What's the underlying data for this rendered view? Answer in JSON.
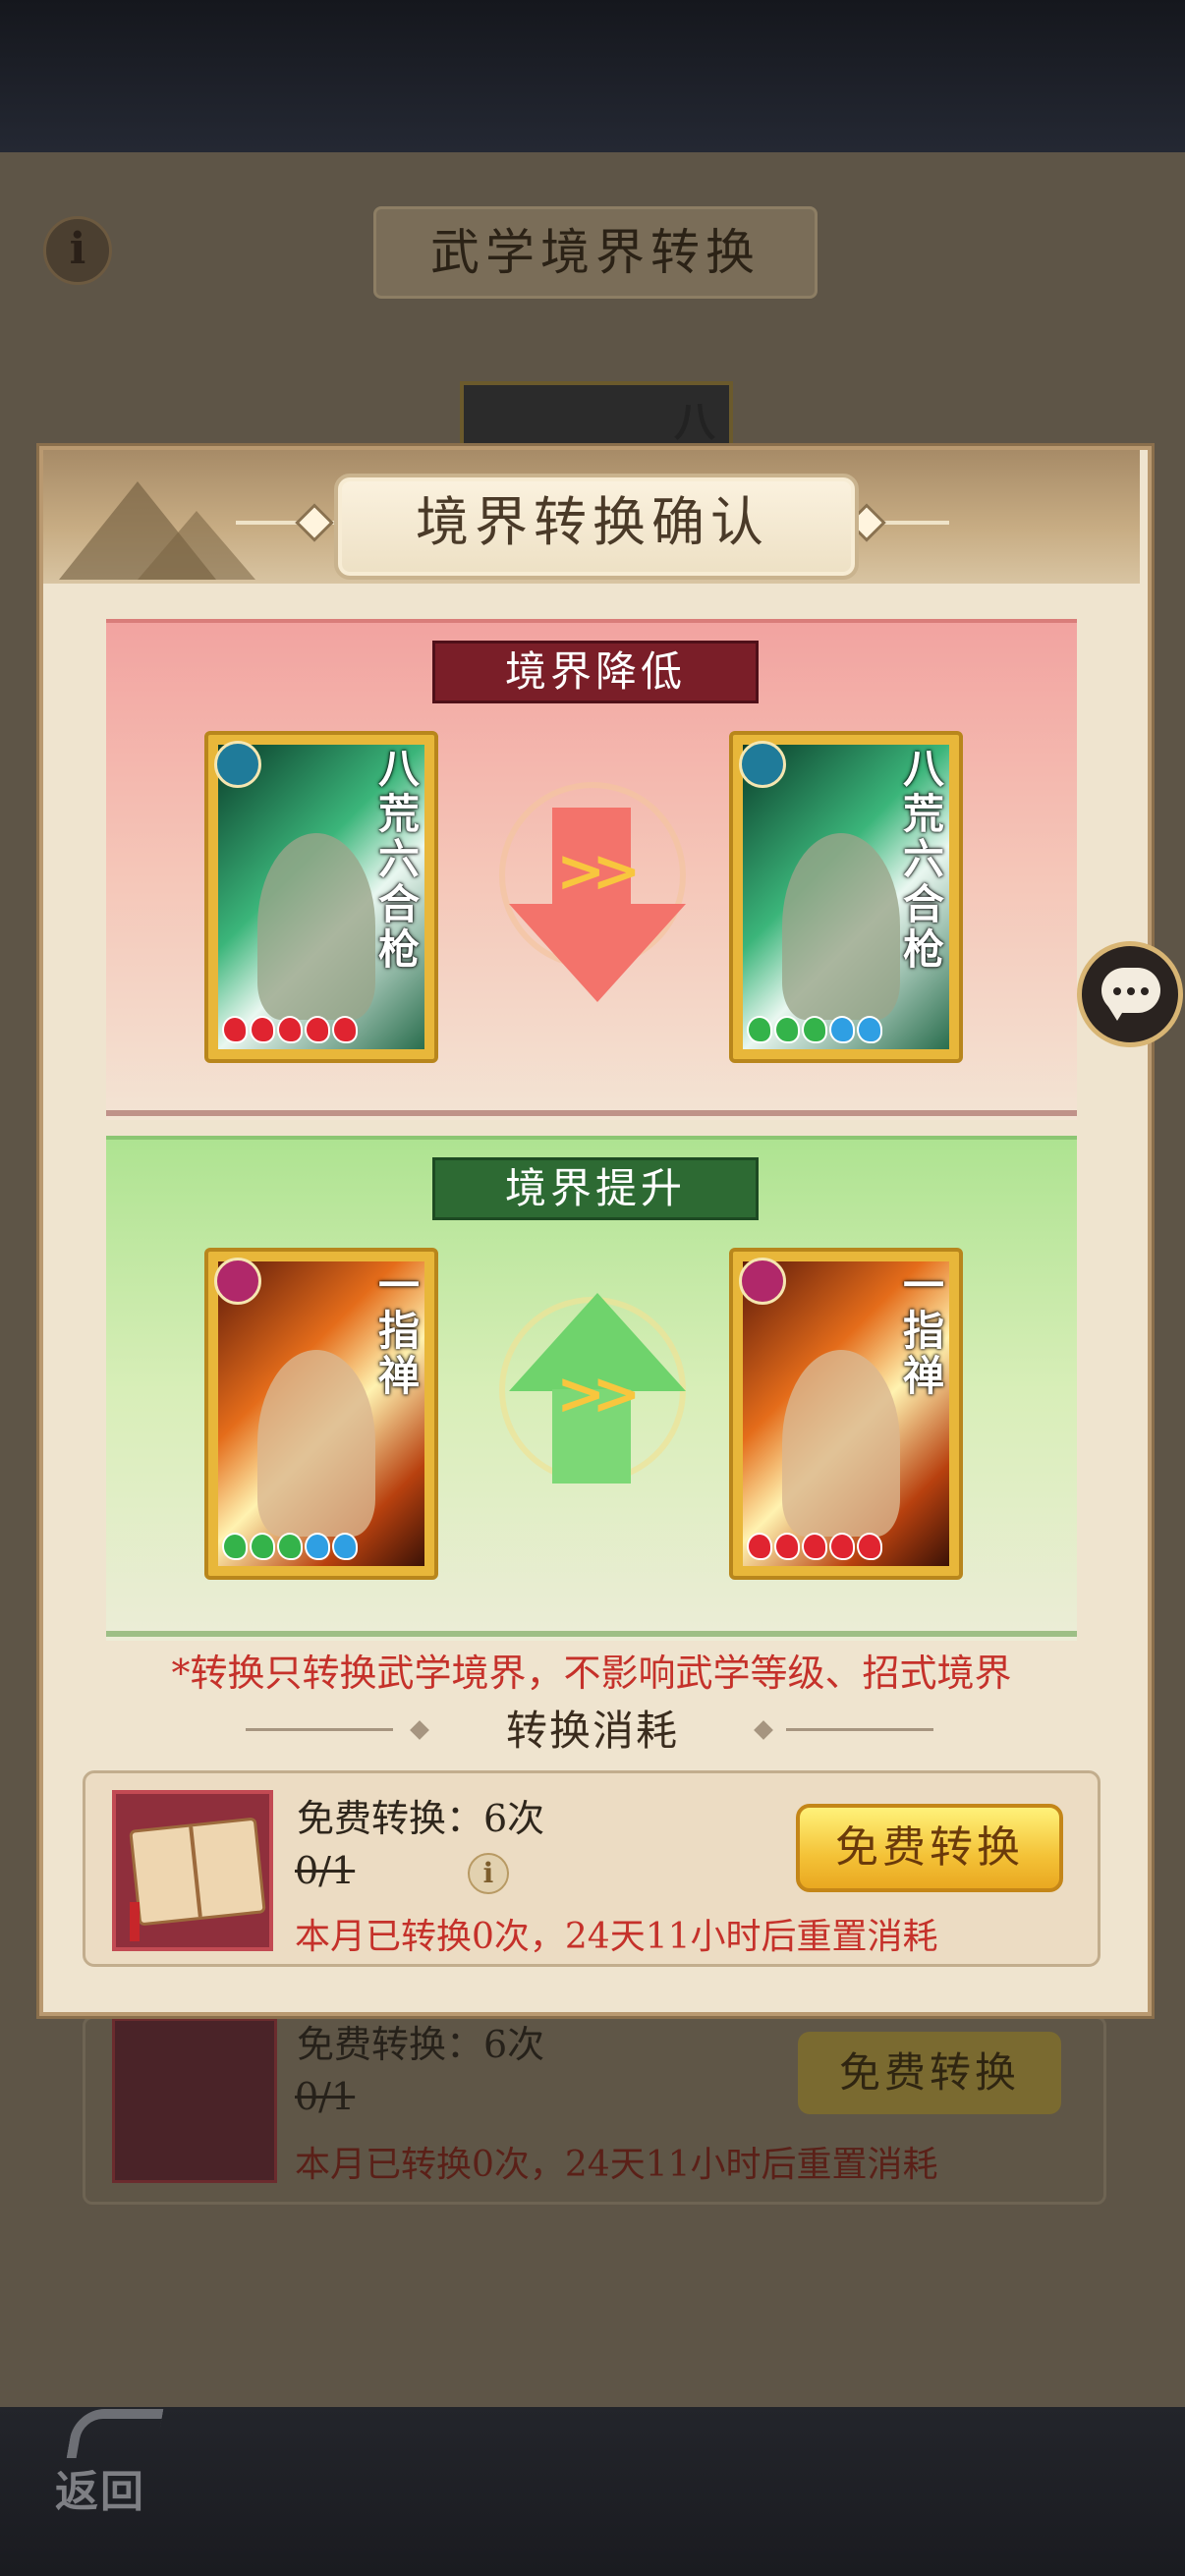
{
  "background": {
    "title": "武学境界转换",
    "info_glyph": "i",
    "card_name_glimpse": "八",
    "cost_row": {
      "free_count": "免费转换：6次",
      "quota": "0/1",
      "reset_note": "本月已转换0次，24天11小时后重置消耗",
      "button": "免费转换"
    }
  },
  "back_button": {
    "label": "返回",
    "icon": "back-arrow-icon"
  },
  "modal": {
    "title": "境界转换确认",
    "downgrade": {
      "banner": "境界降低",
      "card_from": {
        "name": "八荒六合枪",
        "level": 5,
        "pip_colors": [
          "#e02430",
          "#e02430",
          "#e02430",
          "#e02430",
          "#e02430"
        ]
      },
      "card_to": {
        "name": "八荒六合枪",
        "level": 5,
        "pip_colors": [
          "#34b34a",
          "#34b34a",
          "#34b34a",
          "#2f9fe3",
          "#2f9fe3"
        ]
      },
      "arrow": ">>"
    },
    "upgrade": {
      "banner": "境界提升",
      "card_from": {
        "name": "一指禅",
        "level": 5,
        "pip_colors": [
          "#34b34a",
          "#34b34a",
          "#34b34a",
          "#2f9fe3",
          "#2f9fe3"
        ]
      },
      "card_to": {
        "name": "一指禅",
        "level": 5,
        "pip_colors": [
          "#e02430",
          "#e02430",
          "#e02430",
          "#e02430",
          "#e02430"
        ]
      },
      "arrow": ">>"
    },
    "notice": "*转换只转换武学境界，不影响武学等级、招式境界",
    "cost_title": "转换消耗",
    "cost_row": {
      "free_count": "免费转换：6次",
      "quota": "0/1",
      "info_glyph": "i",
      "reset_note": "本月已转换0次，24天11小时后重置消耗",
      "button": "免费转换"
    }
  },
  "colors": {
    "red_banner": "#7a1e28",
    "green_banner": "#2d6a33",
    "button_gold": "#f4c237",
    "notice_red": "#c5312a"
  }
}
